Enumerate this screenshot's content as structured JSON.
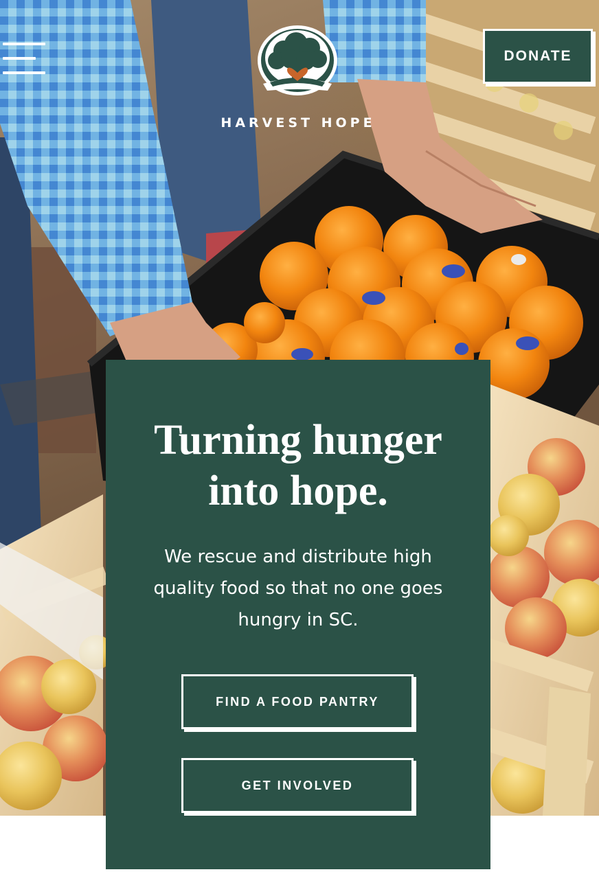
{
  "header": {
    "menu_icon": "hamburger-menu-icon",
    "logo_icon": "tree-heart-logo-icon",
    "brand_name": "HARVEST HOPE",
    "donate_label": "DONATE"
  },
  "hero": {
    "headline": "Turning hunger into hope.",
    "subtext": "We rescue and distribute high quality food so that no one goes hungry in SC.",
    "buttons": {
      "find_pantry": "FIND A FOOD PANTRY",
      "get_involved": "GET INVOLVED"
    }
  },
  "colors": {
    "brand_green": "#2b5247",
    "text_on_green": "#ffffff",
    "logo_heart": "#c8652a",
    "orange": "#f28a1c",
    "apple": "#e9c45b"
  }
}
